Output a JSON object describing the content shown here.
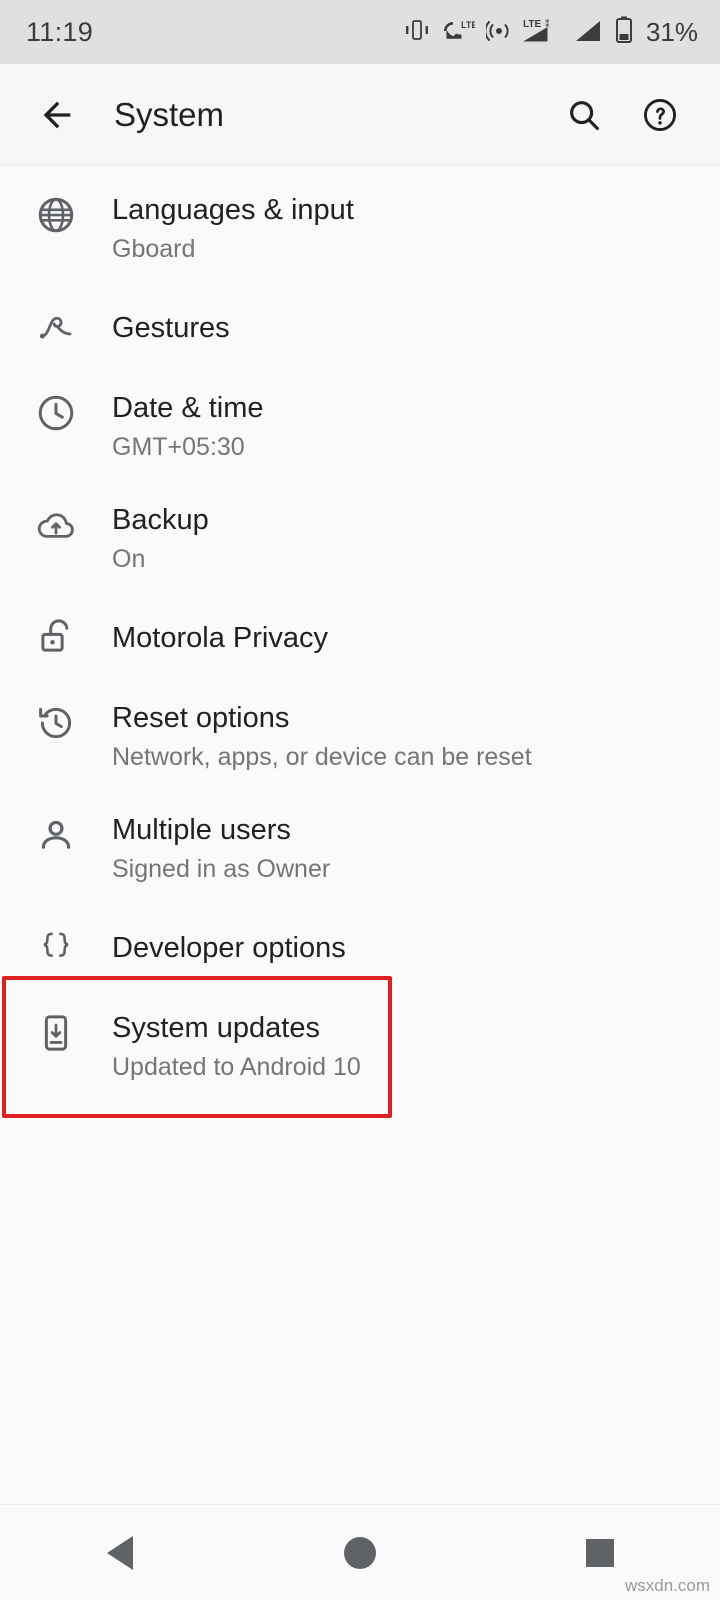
{
  "status_bar": {
    "time": "11:19",
    "battery_percent": "31%",
    "icons": [
      "vibrate-icon",
      "call-lte-icon",
      "hotspot-icon",
      "lte-signal-icon",
      "signal-bars-icon",
      "battery-icon"
    ]
  },
  "app_bar": {
    "title": "System",
    "back_icon": "back-arrow-icon",
    "search_icon": "search-icon",
    "help_icon": "help-circle-icon"
  },
  "settings": {
    "items": [
      {
        "title": "Languages & input",
        "subtitle": "Gboard",
        "icon": "globe-icon"
      },
      {
        "title": "Gestures",
        "subtitle": "",
        "icon": "gesture-icon"
      },
      {
        "title": "Date & time",
        "subtitle": "GMT+05:30",
        "icon": "clock-icon"
      },
      {
        "title": "Backup",
        "subtitle": "On",
        "icon": "cloud-upload-icon"
      },
      {
        "title": "Motorola Privacy",
        "subtitle": "",
        "icon": "unlock-icon"
      },
      {
        "title": "Reset options",
        "subtitle": "Network, apps, or device can be reset",
        "icon": "history-reset-icon"
      },
      {
        "title": "Multiple users",
        "subtitle": "Signed in as Owner",
        "icon": "person-icon"
      },
      {
        "title": "Developer options",
        "subtitle": "",
        "icon": "braces-icon"
      },
      {
        "title": "System updates",
        "subtitle": "Updated to Android 10",
        "icon": "phone-download-icon"
      }
    ],
    "highlight_color": "#e02020"
  },
  "nav_bar": {
    "back": "nav-back-icon",
    "home": "nav-home-icon",
    "recents": "nav-recents-icon"
  },
  "watermark": "wsxdn.com"
}
